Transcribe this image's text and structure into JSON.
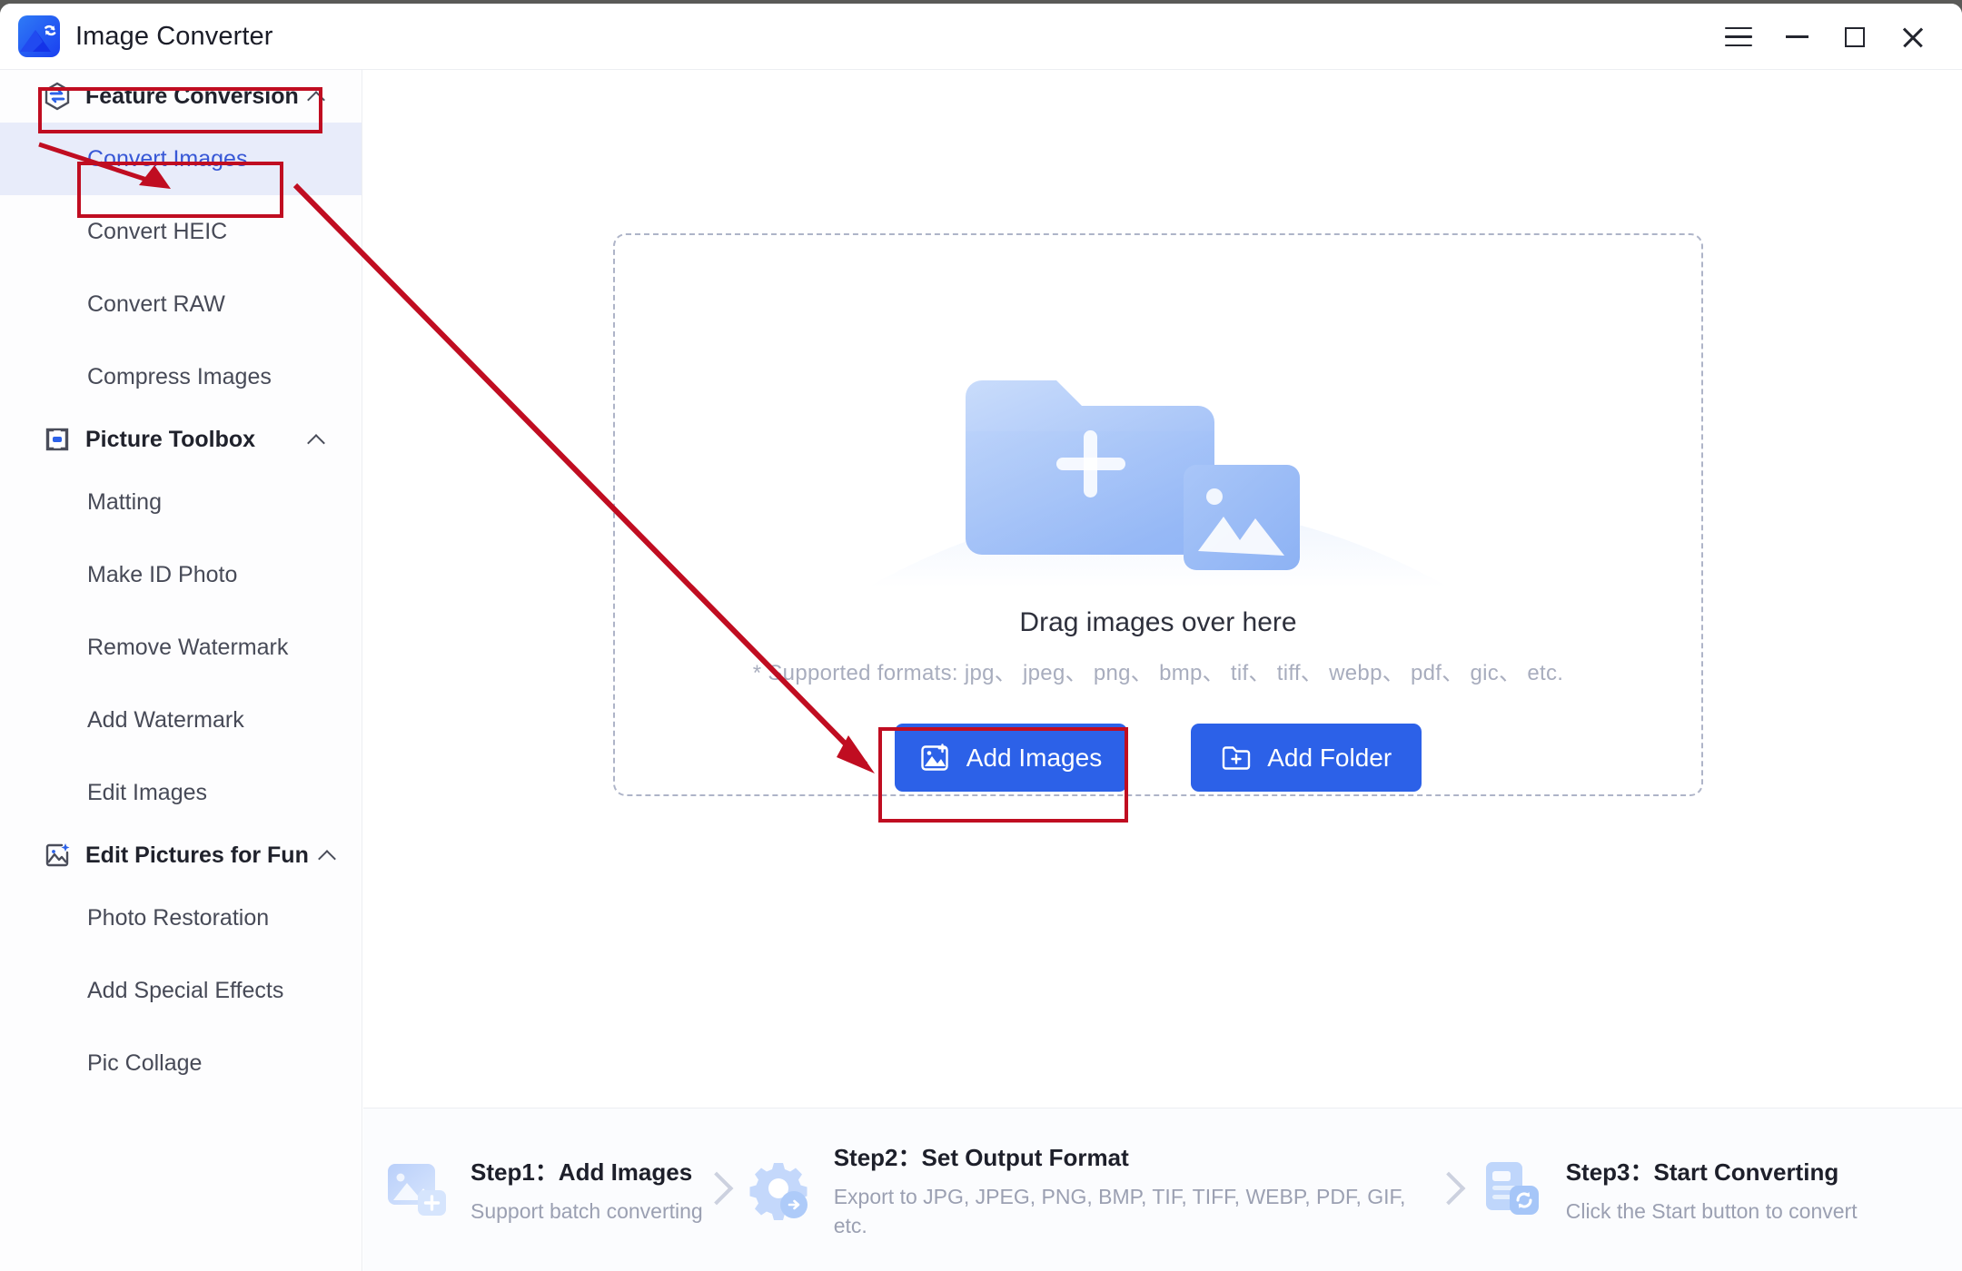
{
  "window": {
    "app_title": "Image Converter",
    "logo_icon": "image-convert-logo-icon",
    "controls": [
      {
        "name": "menu",
        "icon": "hamburger-icon"
      },
      {
        "name": "minimize",
        "icon": "minimize-icon"
      },
      {
        "name": "maximize",
        "icon": "maximize-icon"
      },
      {
        "name": "close",
        "icon": "close-icon"
      }
    ]
  },
  "sidebar": {
    "groups": [
      {
        "label": "Feature Conversion",
        "icon": "hexagon-convert-icon",
        "chevron": "chevron-up-icon",
        "expanded": true,
        "items": [
          {
            "label": "Convert Images",
            "active": true
          },
          {
            "label": "Convert HEIC",
            "active": false
          },
          {
            "label": "Convert RAW",
            "active": false
          },
          {
            "label": "Compress Images",
            "active": false
          }
        ]
      },
      {
        "label": "Picture Toolbox",
        "icon": "toolbox-image-icon",
        "chevron": "chevron-up-icon",
        "expanded": true,
        "items": [
          {
            "label": "Matting",
            "active": false
          },
          {
            "label": "Make ID Photo",
            "active": false
          },
          {
            "label": "Remove Watermark",
            "active": false
          },
          {
            "label": "Add Watermark",
            "active": false
          },
          {
            "label": "Edit Images",
            "active": false
          }
        ]
      },
      {
        "label": "Edit Pictures for Fun",
        "icon": "sparkle-image-icon",
        "chevron": "chevron-up-icon",
        "expanded": true,
        "items": [
          {
            "label": "Photo Restoration",
            "active": false
          },
          {
            "label": "Add Special Effects",
            "active": false
          },
          {
            "label": "Pic Collage",
            "active": false
          }
        ]
      }
    ]
  },
  "dropzone": {
    "illustration_icon": "folder-plus-image-icon",
    "title": "Drag images over here",
    "subtitle": "* Supported formats: jpg、 jpeg、 png、 bmp、 tif、 tiff、 webp、 pdf、 gic、 etc.",
    "buttons": [
      {
        "label": "Add Images",
        "icon": "image-plus-icon"
      },
      {
        "label": "Add Folder",
        "icon": "folder-plus-icon"
      }
    ]
  },
  "steps": [
    {
      "title": "Step1：Add Images",
      "desc": "Support batch converting",
      "icon": "image-add-icon"
    },
    {
      "title": "Step2：Set Output Format",
      "desc": "Export to JPG, JPEG, PNG, BMP, TIF, TIFF, WEBP, PDF, GIF, etc.",
      "icon": "gear-arrow-icon"
    },
    {
      "title": "Step3：Start Converting",
      "desc": "Click the Start button to convert",
      "icon": "document-refresh-icon"
    }
  ],
  "annotations": {
    "color": "#c00d21",
    "boxes": [
      {
        "name": "feature-conversion-highlight"
      },
      {
        "name": "convert-images-highlight"
      },
      {
        "name": "add-images-highlight"
      }
    ],
    "arrows": [
      {
        "name": "arrow-to-convert-images"
      },
      {
        "name": "arrow-to-add-images"
      }
    ]
  },
  "colors": {
    "accent": "#2c61e8",
    "active_nav_text": "#3858d6",
    "active_nav_bg": "#e8ecfa",
    "annotation_red": "#c00d21",
    "muted_text": "#a8adbe"
  }
}
